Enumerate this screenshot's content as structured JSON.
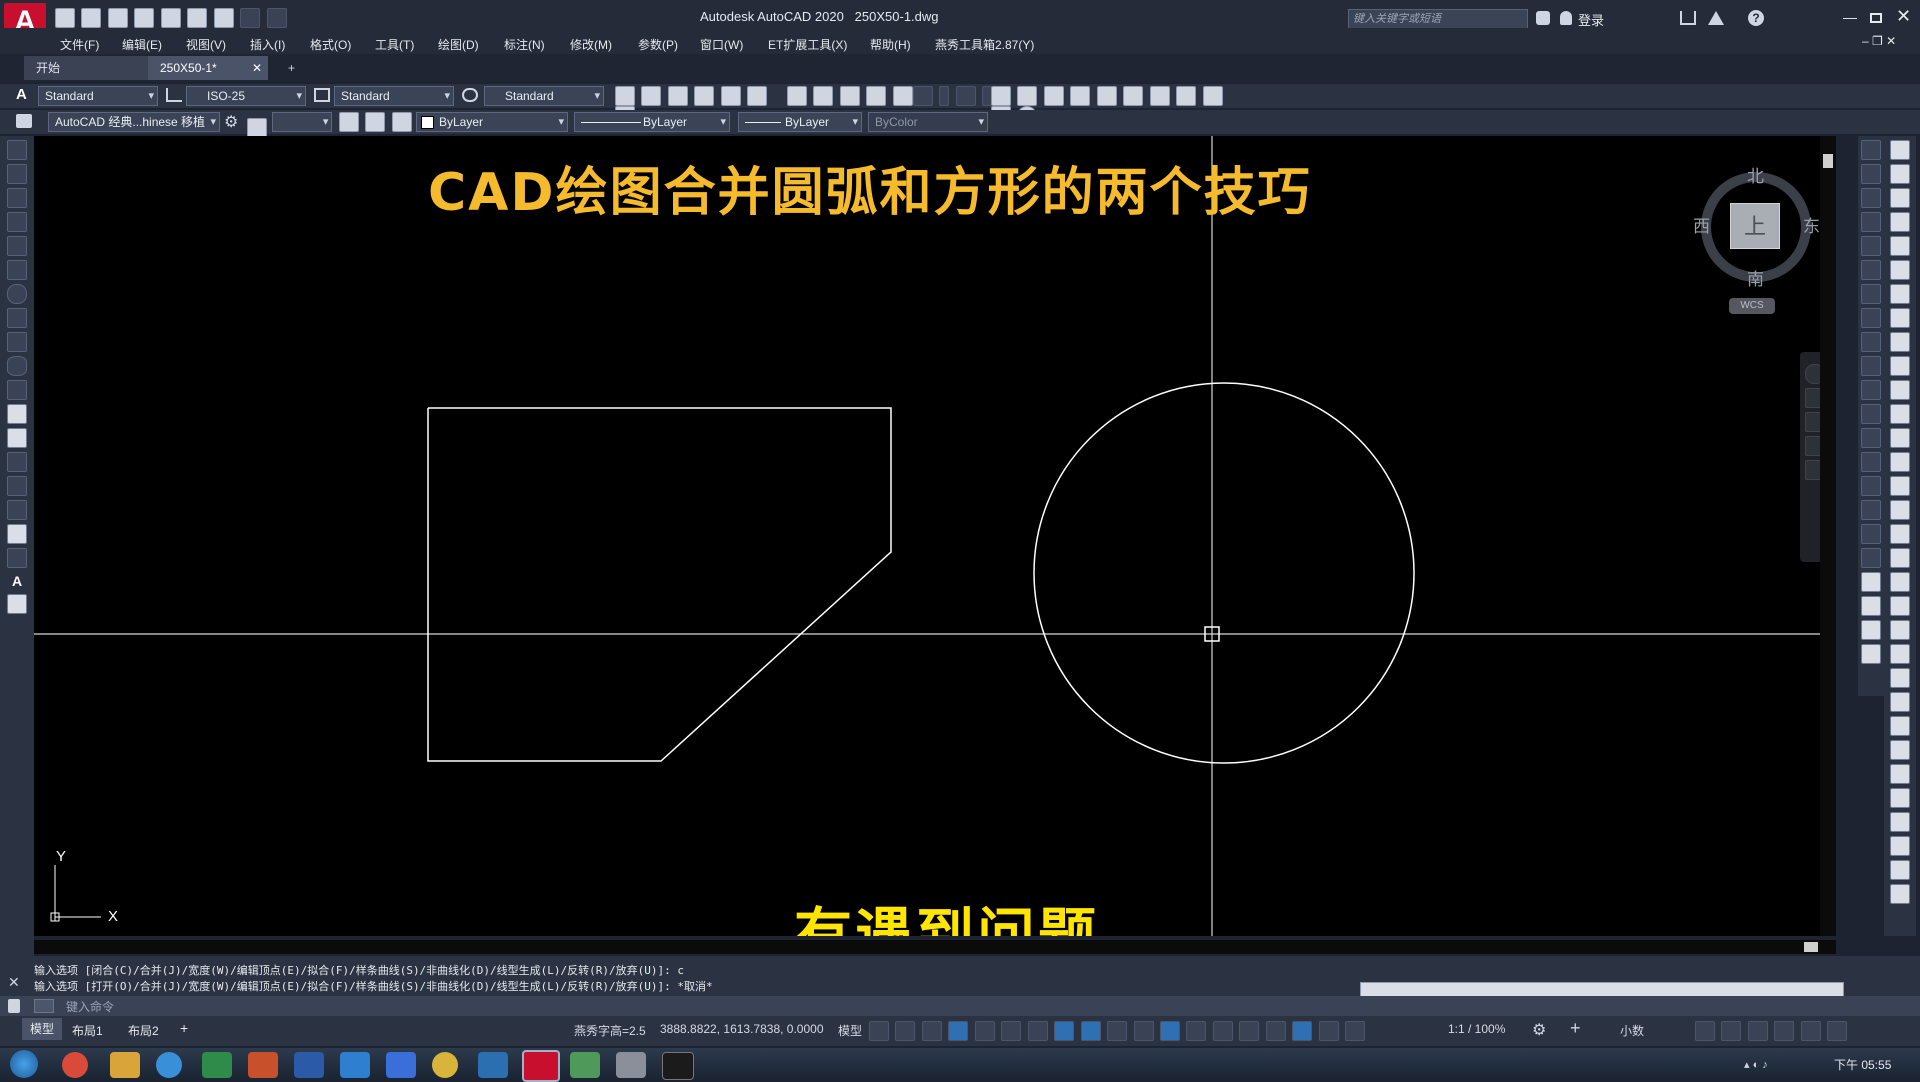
{
  "app": {
    "title": "Autodesk AutoCAD 2020",
    "file": "250X50-1.dwg",
    "search_placeholder": "键入关键字或短语",
    "login": "登录"
  },
  "menu": [
    "文件(F)",
    "编辑(E)",
    "视图(V)",
    "插入(I)",
    "格式(O)",
    "工具(T)",
    "绘图(D)",
    "标注(N)",
    "修改(M)",
    "参数(P)",
    "窗口(W)",
    "ET扩展工具(X)",
    "帮助(H)",
    "燕秀工具箱2.87(Y)"
  ],
  "tabs": {
    "start": "开始",
    "doc": "250X50-1*",
    "add": "+"
  },
  "styles": {
    "text_style": "Standard",
    "dim_style": "ISO-25",
    "table_style": "Standard",
    "mleader_style": "Standard",
    "workspace": "AutoCAD 经典...hinese 移植",
    "layer": "ByLayer",
    "linetype": "ByLayer",
    "lineweight": "ByLayer",
    "plotstyle": "ByColor"
  },
  "canvas": {
    "overlay_title": "CAD绘图合并圆弧和方形的两个技巧",
    "subtitle": "有遇到问题",
    "ucs_x": "X",
    "ucs_y": "Y"
  },
  "viewcube": {
    "north": "北",
    "south": "南",
    "west": "西",
    "east": "东",
    "top": "上",
    "wcs": "WCS"
  },
  "command": {
    "line1": "输入选项 [闭合(C)/合并(J)/宽度(W)/编辑顶点(E)/拟合(F)/样条曲线(S)/非曲线化(D)/线型生成(L)/反转(R)/放弃(U)]: c",
    "line2": "输入选项 [打开(O)/合并(J)/宽度(W)/编辑顶点(E)/拟合(F)/样条曲线(S)/非曲线化(D)/线型生成(L)/反转(R)/放弃(U)]: *取消*",
    "placeholder": "键入命令"
  },
  "layout_tabs": [
    "模型",
    "布局1",
    "布局2",
    "+"
  ],
  "status": {
    "text_height": "燕秀字高=2.5",
    "coords": "3888.8822, 1613.7838, 0.0000",
    "model": "模型",
    "scale": "1:1 / 100%",
    "units": "小数"
  },
  "taskbar": {
    "time": "下午 05:55"
  },
  "colors": {
    "title_yellow": "#f5bb2d",
    "subtitle_yellow": "#ffe500",
    "canvas_bg": "#000000",
    "ui_dark": "#2b3242"
  }
}
